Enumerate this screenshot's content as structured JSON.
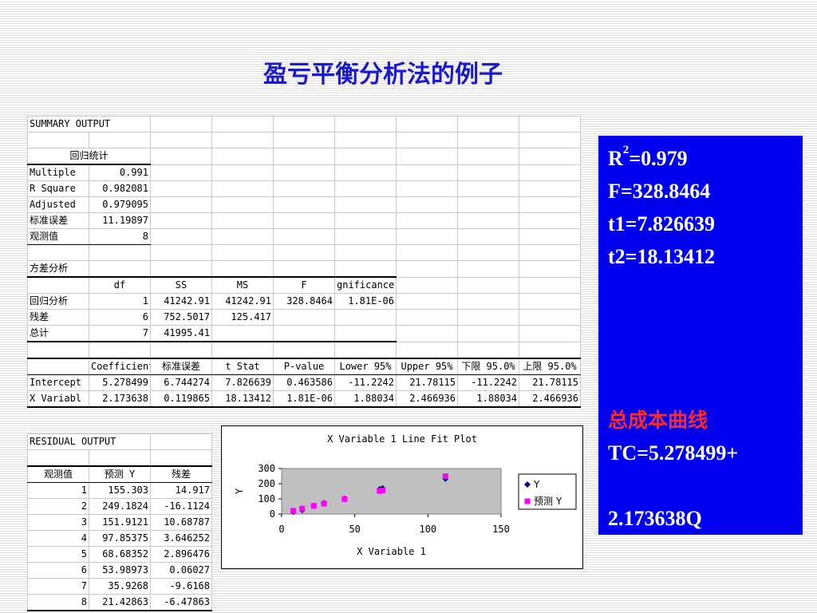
{
  "title": "盈亏平衡分析法的例子",
  "summary": {
    "header": "SUMMARY OUTPUT",
    "reg_stats_title": "回归统计",
    "reg_stats": [
      {
        "label": "Multiple",
        "value": "0.991"
      },
      {
        "label": "R Square",
        "value": "0.982081"
      },
      {
        "label": "Adjusted",
        "value": "0.979095"
      },
      {
        "label": "标准误差",
        "value": "11.19897"
      },
      {
        "label": "观测值",
        "value": "8"
      }
    ],
    "anova_title": "方差分析",
    "anova_headers": [
      "df",
      "SS",
      "MS",
      "F",
      "gnificance F"
    ],
    "anova_rows": [
      {
        "label": "回归分析",
        "cells": [
          "1",
          "41242.91",
          "41242.91",
          "328.8464",
          "1.81E-06"
        ]
      },
      {
        "label": "残差",
        "cells": [
          "6",
          "752.5017",
          "125.417",
          "",
          ""
        ]
      },
      {
        "label": "总计",
        "cells": [
          "7",
          "41995.41",
          "",
          "",
          ""
        ]
      }
    ],
    "coef_headers": [
      "Coefficient",
      "标准误差",
      "t Stat",
      "P-value",
      "Lower 95%",
      "Upper 95%",
      "下限 95.0%",
      "上限 95.0%"
    ],
    "coef_rows": [
      {
        "label": "Intercept",
        "cells": [
          "5.278499",
          "6.744274",
          "7.826639",
          "0.463586",
          "-11.2242",
          "21.78115",
          "-11.2242",
          "21.78115"
        ]
      },
      {
        "label": "X Variabl",
        "cells": [
          "2.173638",
          "0.119865",
          "18.13412",
          "1.81E-06",
          "1.88034",
          "2.466936",
          "1.88034",
          "2.466936"
        ]
      }
    ]
  },
  "residual": {
    "header": "RESIDUAL OUTPUT",
    "columns": [
      "观测值",
      "预测 Y",
      "残差"
    ],
    "rows": [
      [
        "1",
        "155.303",
        "14.917"
      ],
      [
        "2",
        "249.1824",
        "-16.1124"
      ],
      [
        "3",
        "151.9121",
        "10.68787"
      ],
      [
        "4",
        "97.85375",
        "3.646252"
      ],
      [
        "5",
        "68.68352",
        "2.896476"
      ],
      [
        "6",
        "53.98973",
        "0.06027"
      ],
      [
        "7",
        "35.9268",
        "-9.6168"
      ],
      [
        "8",
        "21.42863",
        "-6.47863"
      ]
    ]
  },
  "bluebox": {
    "r2_label": "R",
    "r2_sup": "2",
    "r2_value": "=0.979",
    "f_line": "F=328.8464",
    "t1_line": "t1=7.826639",
    "t2_line": "t2=18.13412",
    "curve_title": "总成本曲线",
    "tc_line": "TC=5.278499+",
    "q_line": "2.173638Q"
  },
  "chart_data": {
    "type": "scatter",
    "title": "X Variable 1 Line Fit  Plot",
    "xlabel": "X Variable 1",
    "ylabel": "Y",
    "xlim": [
      0,
      150
    ],
    "ylim": [
      0,
      300
    ],
    "xticks": [
      0,
      50,
      100,
      150
    ],
    "yticks": [
      0,
      100,
      200,
      300
    ],
    "legend_position": "right",
    "series": [
      {
        "name": "Y",
        "color": "#000080",
        "marker": "diamond",
        "points": [
          [
            69,
            170
          ],
          [
            112,
            233
          ],
          [
            67,
            163
          ],
          [
            43,
            101
          ],
          [
            29,
            72
          ],
          [
            22,
            54
          ],
          [
            14,
            26
          ],
          [
            8,
            15
          ]
        ]
      },
      {
        "name": "预测 Y",
        "color": "#ff00ff",
        "marker": "square",
        "points": [
          [
            69,
            155.303
          ],
          [
            112,
            249.1824
          ],
          [
            67,
            151.9121
          ],
          [
            43,
            97.85375
          ],
          [
            29,
            68.68352
          ],
          [
            22,
            53.98973
          ],
          [
            14,
            35.9268
          ],
          [
            8,
            21.42863
          ]
        ]
      }
    ]
  }
}
